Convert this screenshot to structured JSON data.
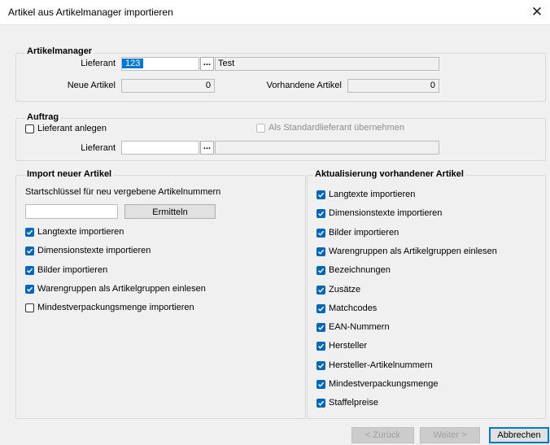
{
  "window": {
    "title": "Artikel aus Artikelmanager importieren",
    "close_glyph": "✕"
  },
  "artikelmanager": {
    "legend": "Artikelmanager",
    "lieferant_label": "Lieferant",
    "lieferant_value": "123",
    "dots": "...",
    "lieferant_name": "Test",
    "neue_label": "Neue Artikel",
    "neue_value": "0",
    "vorhandene_label": "Vorhandene Artikel",
    "vorhandene_value": "0"
  },
  "auftrag": {
    "legend": "Auftrag",
    "lieferant_anlegen": "Lieferant anlegen",
    "standard": "Als Standardlieferant übernehmen",
    "lieferant_label": "Lieferant",
    "lieferant_value": "",
    "dots": "...",
    "lieferant_name": ""
  },
  "import": {
    "legend": "Import neuer Artikel",
    "start_label": "Startschlüssel für neu vergebene Artikelnummern",
    "start_value": "",
    "ermitteln": "Ermitteln",
    "options": [
      {
        "label": "Langtexte importieren",
        "checked": true
      },
      {
        "label": "Dimensionstexte importieren",
        "checked": true
      },
      {
        "label": "Bilder importieren",
        "checked": true
      },
      {
        "label": "Warengruppen als Artikelgruppen einlesen",
        "checked": true
      },
      {
        "label": "Mindestverpackungsmenge importieren",
        "checked": false
      }
    ]
  },
  "update": {
    "legend": "Aktualisierung vorhandener Artikel",
    "options": [
      {
        "label": "Langtexte importieren",
        "checked": true
      },
      {
        "label": "Dimensionstexte importieren",
        "checked": true
      },
      {
        "label": "Bilder importieren",
        "checked": true
      },
      {
        "label": "Warengruppen als Artikelgruppen einlesen",
        "checked": true
      },
      {
        "label": "Bezeichnungen",
        "checked": true
      },
      {
        "label": "Zusätze",
        "checked": true
      },
      {
        "label": "Matchcodes",
        "checked": true
      },
      {
        "label": "EAN-Nummern",
        "checked": true
      },
      {
        "label": "Hersteller",
        "checked": true
      },
      {
        "label": "Hersteller-Artikelnummern",
        "checked": true
      },
      {
        "label": "Mindestverpackungsmenge",
        "checked": true
      },
      {
        "label": "Staffelpreise",
        "checked": true
      }
    ]
  },
  "footer": {
    "back": "< Zurück",
    "next": "Weiter >",
    "cancel": "Abbrechen"
  },
  "colors": {
    "accent": "#0067c0",
    "selection": "#0078d7"
  }
}
